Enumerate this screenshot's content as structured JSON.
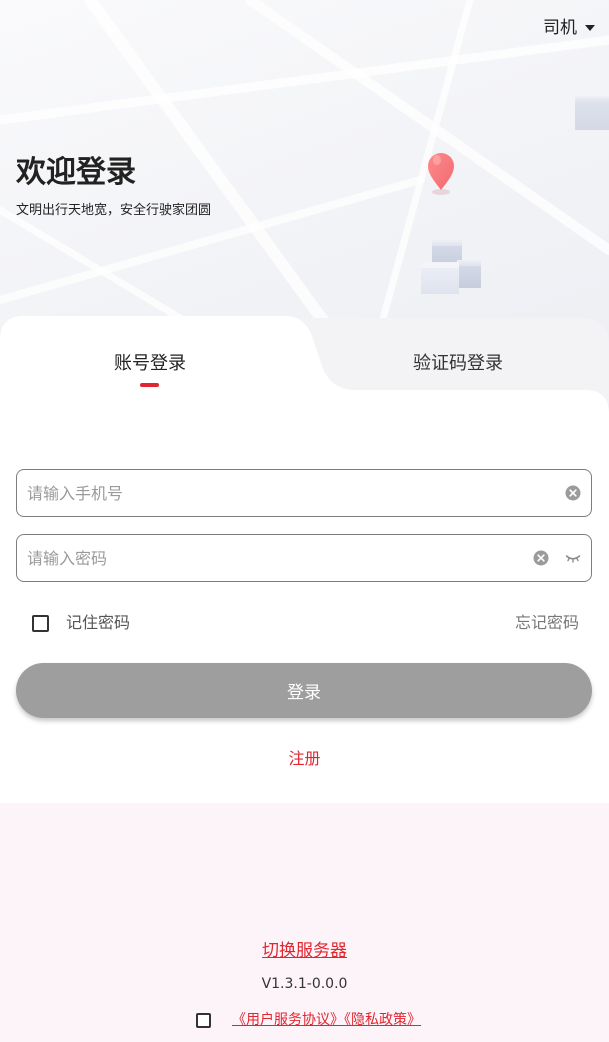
{
  "header": {
    "role_selector": "司机",
    "title": "欢迎登录",
    "subtitle": "文明出行天地宽，安全行驶家团圆"
  },
  "tabs": [
    {
      "label": "账号登录",
      "active": true
    },
    {
      "label": "验证码登录",
      "active": false
    }
  ],
  "form": {
    "phone": {
      "value": "",
      "placeholder": "请输入手机号"
    },
    "password": {
      "value": "",
      "placeholder": "请输入密码"
    },
    "remember_label": "记住密码",
    "remember_checked": false,
    "forgot_label": "忘记密码",
    "login_label": "登录",
    "login_enabled": false,
    "register_label": "注册"
  },
  "footer": {
    "switch_server_label": "切换服务器",
    "version": "V1.3.1-0.0.0",
    "agreement_checked": false,
    "agreement_links": [
      "《用户服务协议》",
      "《隐私政策》"
    ]
  },
  "colors": {
    "accent": "#e0262f",
    "button_disabled": "#9e9e9e",
    "bottom_background": "#fdf4fa"
  },
  "icons": {
    "role_dropdown": "caret-down-icon",
    "clear": "clear-icon",
    "password_visibility": "eye-closed-icon",
    "decoration": "map-pin-icon"
  }
}
